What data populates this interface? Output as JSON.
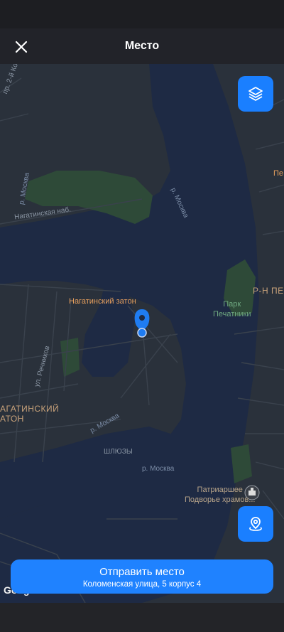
{
  "header": {
    "title": "Место"
  },
  "map": {
    "labels": {
      "street_top_left": "пр. 2-й Ко",
      "river_moskva_1": "р. Москва",
      "river_moskva_2": "р. Москва",
      "river_moskva_3": "р. Москва",
      "river_moskva_4": "р. Москва",
      "nagatinskaya_nab": "Нагатинская наб.",
      "station": "Нагатинский затон",
      "rn_pe": "Р-Н ПЕ",
      "pe_right": "Пе",
      "park": "Парк\nПечатники",
      "ul_rechnikov": "ул. Речников",
      "area_name": "АГАТИНСКИЙ\nАТОН",
      "shlyuzy": "ШЛЮЗЫ",
      "podvorye": "Патриаршее\nПодворье храмов..."
    },
    "colors": {
      "water": "#1e2a44",
      "land": "#2a313b",
      "park": "#2e4a38",
      "pin": "#1f7cf2"
    }
  },
  "controls": {
    "layers_icon": "layers-icon",
    "location_icon": "location-pin-icon"
  },
  "send": {
    "label": "Отправить место",
    "address": "Коломенская улица, 5 корпус 4"
  },
  "google_logo": "Google"
}
